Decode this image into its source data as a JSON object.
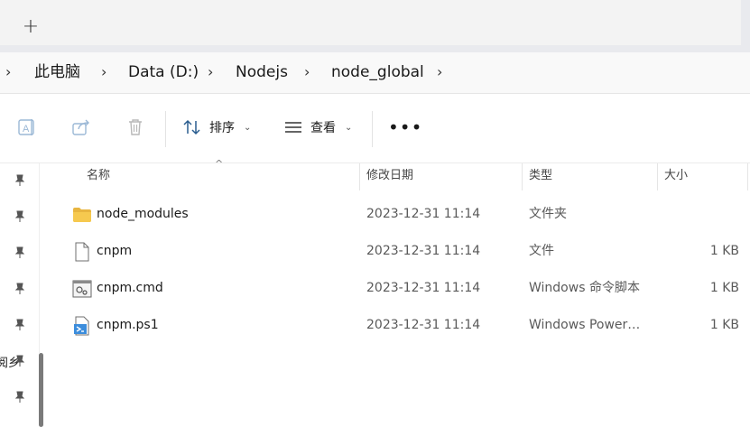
{
  "tabbar": {
    "new_tab": "+"
  },
  "breadcrumb": {
    "items": [
      "此电脑",
      "Data (D:)",
      "Nodejs",
      "node_global"
    ]
  },
  "commandbar": {
    "sort_label": "排序",
    "view_label": "查看",
    "more_label": "•••"
  },
  "nav": {
    "clipped_text": "阅乡"
  },
  "columns": {
    "name": "名称",
    "modified": "修改日期",
    "type": "类型",
    "size": "大小"
  },
  "files": [
    {
      "name": "node_modules",
      "modified": "2023-12-31 11:14",
      "type": "文件夹",
      "size": "",
      "icon": "folder-icon"
    },
    {
      "name": "cnpm",
      "modified": "2023-12-31 11:14",
      "type": "文件",
      "size": "1 KB",
      "icon": "file-icon"
    },
    {
      "name": "cnpm.cmd",
      "modified": "2023-12-31 11:14",
      "type": "Windows 命令脚本",
      "size": "1 KB",
      "icon": "cmd-file-icon"
    },
    {
      "name": "cnpm.ps1",
      "modified": "2023-12-31 11:14",
      "type": "Windows Power…",
      "size": "1 KB",
      "icon": "powershell-file-icon"
    }
  ],
  "colors": {
    "folder": "#f2c14e",
    "accent": "#3c8ddc"
  }
}
